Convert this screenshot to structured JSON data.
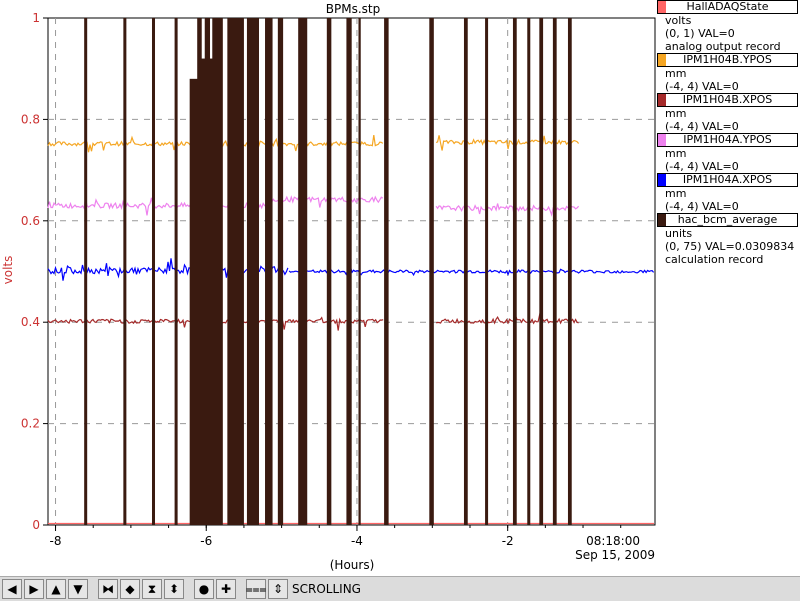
{
  "title": "BPMs.stp",
  "colors": {
    "HallADAQState": "#ff6666",
    "IPM1H04B.YPOS": "#f5a623",
    "IPM1H04B.XPOS": "#a52a2a",
    "IPM1H04A.YPOS": "#ee82ee",
    "IPM1H04A.XPOS": "#0000ff",
    "hac_bcm_average": "#3a1a10"
  },
  "legend": [
    {
      "name": "HallADAQState",
      "color": "#ff6666",
      "lines": [
        "volts",
        "(0, 1)  VAL=0",
        "analog output record"
      ]
    },
    {
      "name": "IPM1H04B.YPOS",
      "color": "#f5a623",
      "lines": [
        "mm",
        "(-4, 4) VAL=0"
      ]
    },
    {
      "name": "IPM1H04B.XPOS",
      "color": "#a52a2a",
      "lines": [
        "mm",
        "(-4, 4) VAL=0"
      ]
    },
    {
      "name": "IPM1H04A.YPOS",
      "color": "#ee82ee",
      "lines": [
        "mm",
        "(-4, 4) VAL=0"
      ]
    },
    {
      "name": "IPM1H04A.XPOS",
      "color": "#0000ff",
      "lines": [
        "mm",
        "(-4, 4) VAL=0"
      ]
    },
    {
      "name": "hac_bcm_average",
      "color": "#3a1a10",
      "lines": [
        "units",
        "(0, 75) VAL=0.0309834",
        "calculation record"
      ]
    }
  ],
  "toolbar": {
    "status": "SCROLLING",
    "buttons": [
      {
        "name": "scroll-left-icon",
        "glyph": "◀"
      },
      {
        "name": "scroll-right-icon",
        "glyph": "▶"
      },
      {
        "name": "scroll-up-icon",
        "glyph": "▲"
      },
      {
        "name": "scroll-down-icon",
        "glyph": "▼"
      },
      {
        "name": "zoom-in-x-icon",
        "glyph": "⧓"
      },
      {
        "name": "zoom-out-x-icon",
        "glyph": "◆"
      },
      {
        "name": "zoom-in-y-icon",
        "glyph": "⧗"
      },
      {
        "name": "zoom-out-y-icon",
        "glyph": "⬍"
      },
      {
        "name": "record-icon",
        "glyph": "●"
      },
      {
        "name": "crosshair-icon",
        "glyph": "✚"
      },
      {
        "name": "toggle-scrolling-icon",
        "glyph": "⩶"
      },
      {
        "name": "autoscale-icon",
        "glyph": "⇕"
      }
    ]
  },
  "chart_data": {
    "type": "line",
    "title": "BPMs.stp",
    "xlabel": "(Hours)",
    "ylabel": "volts",
    "xlim": [
      -8.1,
      -0.045
    ],
    "ylim": [
      0,
      1
    ],
    "xticks": [
      -8,
      -6,
      -4,
      -2
    ],
    "yticks": [
      0,
      0.2,
      0.4,
      0.6,
      0.8,
      1
    ],
    "ytick_labels": [
      "0",
      "0.2",
      "0.4",
      "0.6",
      "0.8",
      "1"
    ],
    "xtick_labels": [
      "-8",
      "-6",
      "-4",
      "-2"
    ],
    "end_time": "08:18:00",
    "end_date": "Sep 15, 2009",
    "grid": true,
    "series": [
      {
        "name": "HallADAQState",
        "color": "#ff6666",
        "segments": [
          {
            "x": [
              -8.1,
              -0.045
            ],
            "base": 0.003,
            "noise": 0,
            "spike": 0
          }
        ]
      },
      {
        "name": "IPM1H04B.YPOS",
        "color": "#f5a623",
        "segments": [
          {
            "x": [
              -8.1,
              -6.15
            ],
            "base": 0.752,
            "noise": 0.004,
            "spike": 0.02
          },
          {
            "x": [
              -6.1,
              -5.2
            ],
            "base": 0.752,
            "noise": 0.006,
            "spike": 0.03
          },
          {
            "x": [
              -5.15,
              -3.65
            ],
            "base": 0.752,
            "noise": 0.004,
            "spike": 0.02
          },
          {
            "x": [
              -2.95,
              -1.05
            ],
            "base": 0.755,
            "noise": 0.004,
            "spike": 0.02
          }
        ]
      },
      {
        "name": "IPM1H04A.YPOS",
        "color": "#ee82ee",
        "segments": [
          {
            "x": [
              -8.1,
              -6.15
            ],
            "base": 0.63,
            "noise": 0.005,
            "spike": 0.02
          },
          {
            "x": [
              -6.1,
              -5.2
            ],
            "base": 0.63,
            "noise": 0.006,
            "spike": 0.02
          },
          {
            "x": [
              -5.15,
              -3.65
            ],
            "base": 0.642,
            "noise": 0.005,
            "spike": 0.02
          },
          {
            "x": [
              -2.95,
              -1.05
            ],
            "base": 0.625,
            "noise": 0.005,
            "spike": 0.02
          }
        ]
      },
      {
        "name": "IPM1H04A.XPOS",
        "color": "#0000ff",
        "segments": [
          {
            "x": [
              -8.1,
              -6.15
            ],
            "base": 0.502,
            "noise": 0.006,
            "spike": 0.02
          },
          {
            "x": [
              -6.15,
              -4.9
            ],
            "base": 0.502,
            "noise": 0.008,
            "spike": 0.03
          },
          {
            "x": [
              -4.9,
              -0.045
            ],
            "base": 0.5,
            "noise": 0.003,
            "spike": 0.008
          }
        ]
      },
      {
        "name": "IPM1H04B.XPOS",
        "color": "#a52a2a",
        "segments": [
          {
            "x": [
              -8.1,
              -6.15
            ],
            "base": 0.402,
            "noise": 0.004,
            "spike": 0.015
          },
          {
            "x": [
              -6.1,
              -3.65
            ],
            "base": 0.402,
            "noise": 0.004,
            "spike": 0.015
          },
          {
            "x": [
              -2.95,
              -1.05
            ],
            "base": 0.402,
            "noise": 0.004,
            "spike": 0.015
          }
        ]
      }
    ],
    "bcm_bursts": [
      -7.62,
      -7.58,
      -7.1,
      -7.06,
      -6.72,
      -6.68,
      -6.42,
      -6.38,
      -6.12,
      -6.06,
      -6.02,
      -5.95,
      -5.92,
      -5.78,
      -5.72,
      -5.5,
      -5.46,
      -5.3,
      -5.22,
      -5.12,
      -5.05,
      -4.98,
      -4.78,
      -4.66,
      -4.4,
      -4.34,
      -4.14,
      -4.07,
      -3.98,
      -3.95,
      -3.64,
      -3.58,
      -3.04,
      -2.98,
      -2.58,
      -2.53,
      -2.3,
      -2.26,
      -1.93,
      -1.88,
      -1.74,
      -1.7,
      -1.58,
      -1.53,
      -1.4,
      -1.35,
      -1.2,
      -1.15
    ],
    "bcm_partial": [
      {
        "x": [
          -6.22,
          -6.1
        ],
        "y": 0.88
      },
      {
        "x": [
          -6.1,
          -5.85
        ],
        "y": 0.92
      }
    ]
  }
}
